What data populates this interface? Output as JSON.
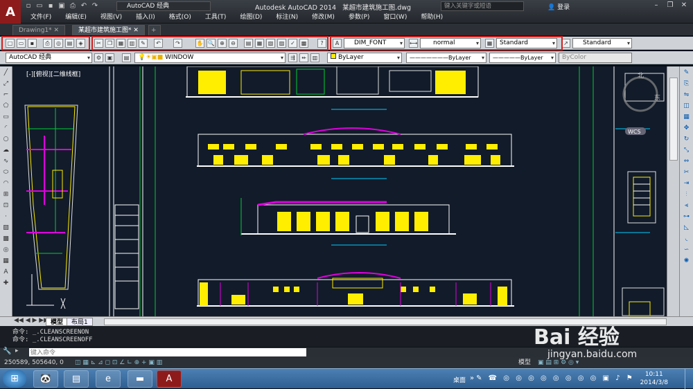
{
  "title_bar": {
    "app_title": "Autodesk AutoCAD 2014",
    "file_title": "某超市建筑施工图.dwg",
    "workspace": "AutoCAD 经典",
    "search_placeholder": "键入关键字或短语",
    "login": "登录"
  },
  "menu": [
    "文件(F)",
    "编辑(E)",
    "视图(V)",
    "插入(I)",
    "格式(O)",
    "工具(T)",
    "绘图(D)",
    "标注(N)",
    "修改(M)",
    "参数(P)",
    "窗口(W)",
    "帮助(H)"
  ],
  "doc_tabs": [
    "Drawing1*",
    "某超市建筑施工图*"
  ],
  "toolbar_styles": {
    "text_style": "DIM_FONT",
    "dim_style": "normal",
    "table_style": "Standard",
    "multileader_style": "Standard"
  },
  "toolbar_layers": {
    "workspace2": "AutoCAD 经典",
    "layer": "WINDOW",
    "color": "ByLayer",
    "linetype": "ByLayer",
    "lineweight": "ByLayer",
    "plotstyle": "ByColor"
  },
  "viewport_label": "[-][俯视][二维线框]",
  "viewcube": {
    "north": "北",
    "east": "东",
    "wcs": "WCS"
  },
  "layout_tabs": [
    "模型",
    "布局1"
  ],
  "command_history": [
    "命令: _.CLEANSCREENON",
    "命令: _.CLEANSCREENOFF"
  ],
  "command_prompt": "键入命令",
  "coordinates": "250589, 505640, 0",
  "status_model": "模型",
  "clock": {
    "time": "10:11",
    "date": "2014/3/8"
  },
  "taskbar_desktop": "桌面",
  "watermark": {
    "brand": "Bai 经验",
    "url": "jingyan.baidu.com"
  },
  "colors": {
    "accent_red": "#d02020",
    "canvas_bg": "#121b2a",
    "yellow": "#ffee00",
    "magenta": "#e000e0",
    "green": "#00cc33"
  }
}
